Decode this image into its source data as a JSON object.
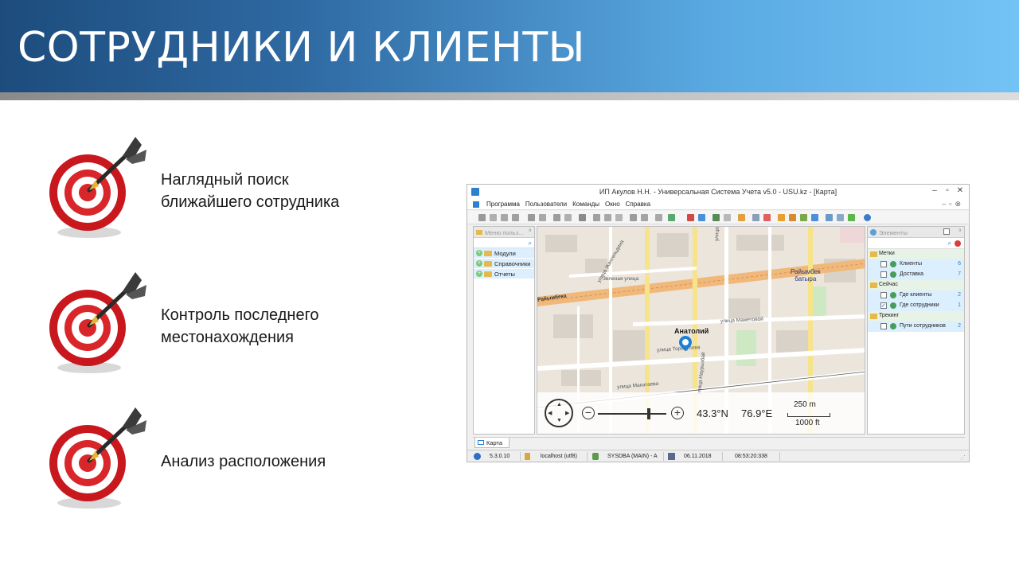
{
  "header": {
    "title": "СОТРУДНИКИ И КЛИЕНТЫ"
  },
  "bullets": [
    {
      "line1": "Наглядный поиск",
      "line2": "ближайшего сотрудника"
    },
    {
      "line1": "Контроль последнего",
      "line2": "местонахождения"
    },
    {
      "line1": "Анализ расположения",
      "line2": ""
    }
  ],
  "app": {
    "window_title": "ИП Акулов Н.Н. - Универсальная Система Учета v5.0 - USU.kz - [Карта]",
    "window_controls": {
      "minimize": "–",
      "restore": "▫",
      "close": "✕"
    },
    "menu": [
      "Программа",
      "Пользователи",
      "Команды",
      "Окно",
      "Справка"
    ],
    "left_panel": {
      "title": "Меню польз...",
      "items": [
        "Модули",
        "Справочники",
        "Отчеты"
      ]
    },
    "map": {
      "marker_label": "Анатолий",
      "metro_label_1": "Райымбек",
      "metro_label_2": "батыра",
      "streets": {
        "s1": "улица Жангельдина",
        "s2": "Зеленая улица",
        "s3": "Райымбека",
        "s4": "улица Желтоксан",
        "s5": "улица Маметовой",
        "s6": "улица Торекулова",
        "s7": "улица Наурызбай",
        "s8": "улица Макатаева"
      },
      "lat": "43.3°N",
      "lon": "76.9°E",
      "scale_metric": "250 m",
      "scale_imperial": "1000 ft"
    },
    "right_panel": {
      "title": "Элементы",
      "groups": [
        {
          "name": "Метки",
          "items": [
            {
              "label": "Клиенты",
              "count": "6",
              "checked": false
            },
            {
              "label": "Доставка",
              "count": "7",
              "checked": false
            }
          ]
        },
        {
          "name": "Сейчас",
          "items": [
            {
              "label": "Где клиенты",
              "count": "2",
              "checked": false
            },
            {
              "label": "Где сотрудники",
              "count": "1",
              "checked": true
            }
          ]
        },
        {
          "name": "Трекинг",
          "items": [
            {
              "label": "Пути сотрудников",
              "count": "2",
              "checked": false
            }
          ]
        }
      ]
    },
    "tab_label": "Карта",
    "status": {
      "version": "5.3.0.10",
      "db": "localhost (utf8)",
      "user": "SYSDBA (MAIN) - A",
      "date": "06.11.2018",
      "time": "08:53:20:338"
    }
  },
  "colors": {
    "accent_blue": "#2d7fd0",
    "header_dark": "#1d4c7d",
    "header_light": "#73c3f6",
    "target_red": "#d9262a"
  }
}
